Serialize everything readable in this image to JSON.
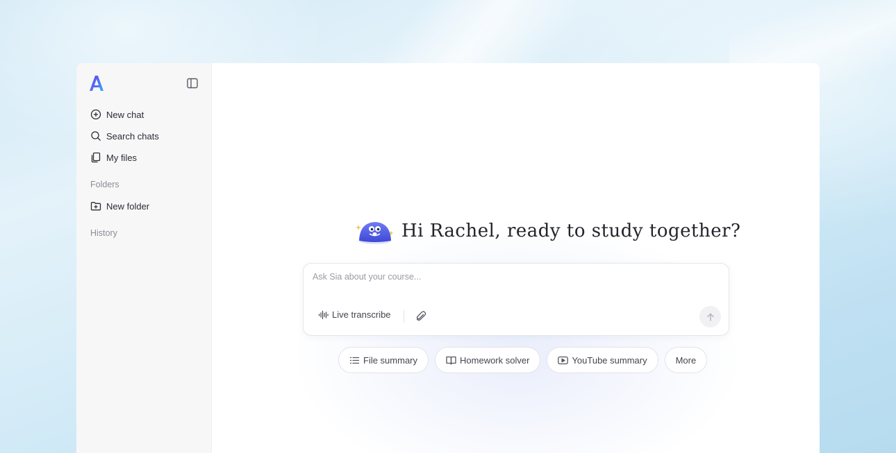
{
  "sidebar": {
    "logo_icon": "app-logo-icon",
    "collapse_icon": "sidebar-toggle-icon",
    "nav": [
      {
        "label": "New chat",
        "icon": "plus-circle-icon"
      },
      {
        "label": "Search chats",
        "icon": "search-icon"
      },
      {
        "label": "My files",
        "icon": "files-icon"
      }
    ],
    "folders_label": "Folders",
    "new_folder_label": "New folder",
    "new_folder_icon": "folder-plus-icon",
    "history_label": "History"
  },
  "main": {
    "greeting": "Hi Rachel, ready to study together?",
    "mascot_icon": "mascot-icon",
    "input": {
      "placeholder": "Ask Sia about your course...",
      "value": "",
      "live_transcribe_label": "Live transcribe",
      "live_transcribe_icon": "waveform-icon",
      "attach_icon": "paperclip-icon",
      "send_icon": "arrow-up-icon"
    },
    "chips": [
      {
        "label": "File summary",
        "icon": "list-icon"
      },
      {
        "label": "Homework solver",
        "icon": "book-open-icon"
      },
      {
        "label": "YouTube summary",
        "icon": "youtube-icon"
      },
      {
        "label": "More",
        "icon": ""
      }
    ]
  },
  "colors": {
    "accent": "#4f5fe6",
    "logo_gradient": [
      "#5b3cf0",
      "#3aa0f5"
    ],
    "text_primary": "#23232b",
    "text_muted": "#8c8c96"
  }
}
